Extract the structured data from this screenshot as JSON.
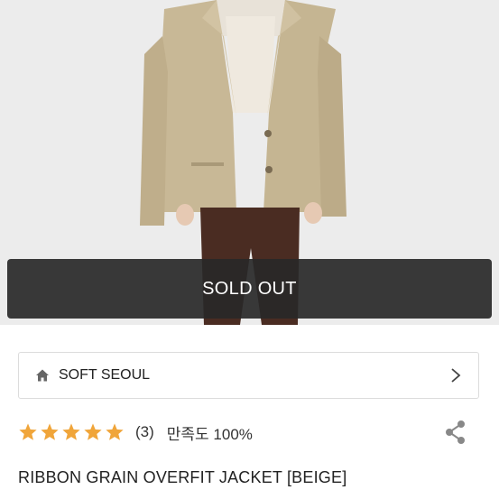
{
  "banner": {
    "status": "SOLD OUT"
  },
  "brand": {
    "name": "SOFT SEOUL",
    "icon": "home-icon"
  },
  "rating": {
    "stars": 5,
    "max_stars": 5,
    "review_count": "(3)",
    "satisfaction": "만족도 100%"
  },
  "product": {
    "title": "RIBBON GRAIN OVERFIT JACKET [BEIGE]"
  },
  "colors": {
    "star": "#f0a53a",
    "banner": "#282828",
    "jacket": "#c9b99a",
    "pants": "#4a2c22"
  }
}
